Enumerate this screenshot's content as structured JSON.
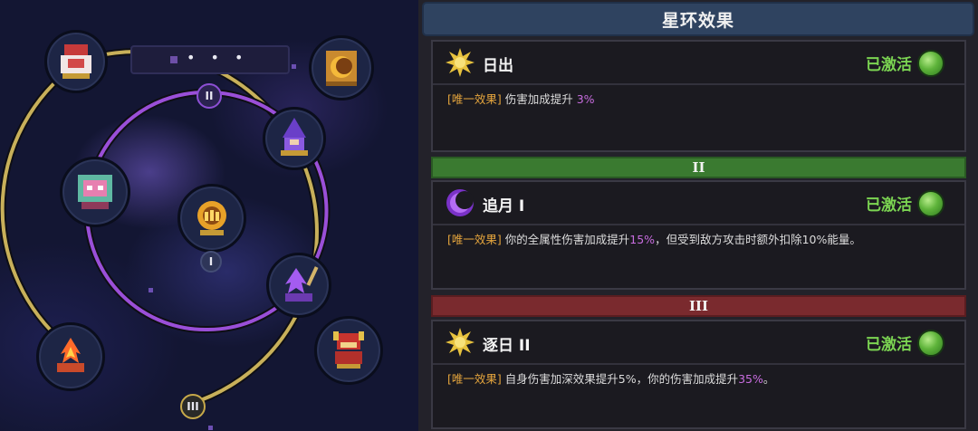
{
  "map": {
    "menu_dots": "• • •",
    "badges": {
      "inner": "II",
      "center": "I",
      "outer": "III"
    },
    "nodes": [
      {
        "name": "shrine-maiden-icon"
      },
      {
        "name": "sun-mirror-icon"
      },
      {
        "name": "dragon-mask-icon"
      },
      {
        "name": "wizard-icon"
      },
      {
        "name": "core-relic-icon"
      },
      {
        "name": "violet-flame-icon"
      },
      {
        "name": "fire-bowl-icon"
      },
      {
        "name": "armored-knight-icon"
      }
    ]
  },
  "panel": {
    "title": "星环效果",
    "dividers": {
      "tier2": "II",
      "tier3": "III"
    },
    "cards": [
      {
        "icon": "sun-icon",
        "name": "日出",
        "status": "已激活",
        "tag": "[唯一效果]",
        "desc_prefix": "伤害加成提升 ",
        "desc_highlight": "3%",
        "desc_suffix": ""
      },
      {
        "icon": "crescent-moon-icon",
        "name": "追月 I",
        "status": "已激活",
        "tag": "[唯一效果]",
        "desc_prefix": "你的全属性伤害加成提升",
        "desc_highlight": "15%",
        "desc_suffix": "，但受到敌方攻击时额外扣除10%能量。"
      },
      {
        "icon": "sun-icon",
        "name": "逐日 II",
        "status": "已激活",
        "tag": "[唯一效果]",
        "desc_prefix": "自身伤害加深效果提升5%，你的伤害加成提升",
        "desc_highlight": "35%",
        "desc_suffix": "。"
      }
    ]
  },
  "colors": {
    "status_active": "#7bd452",
    "tag": "#e5a53d",
    "highlight": "#c96de0",
    "outer_ring": "#c8b05a",
    "inner_ring": "#9a4fd8",
    "tier2_bar": "#3a7a30",
    "tier3_bar": "#7a2a2e"
  }
}
